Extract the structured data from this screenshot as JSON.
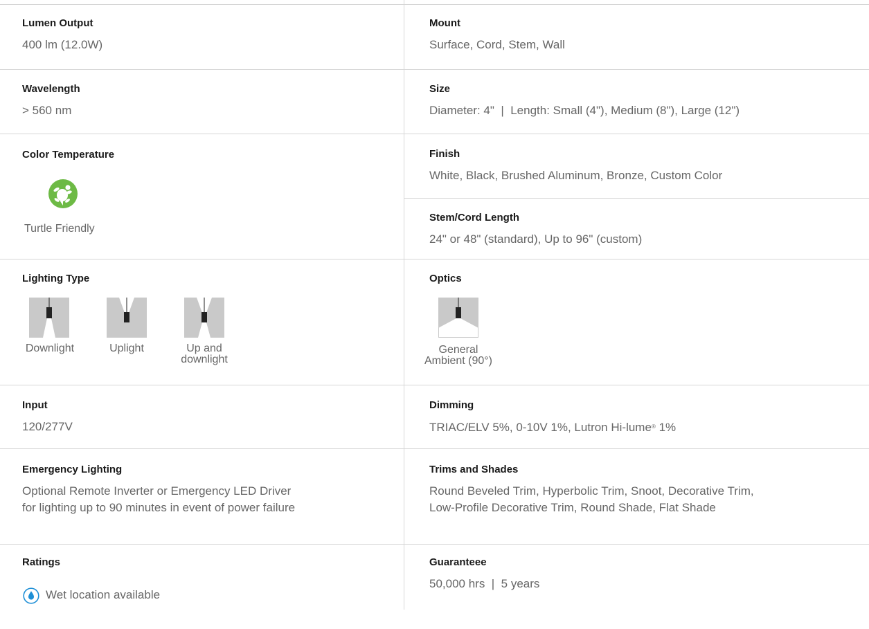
{
  "specs": {
    "lumen": {
      "label": "Lumen Output",
      "value": "400 lm (12.0W)"
    },
    "mount": {
      "label": "Mount",
      "value": "Surface, Cord, Stem, Wall"
    },
    "wavelength": {
      "label": "Wavelength",
      "value": "> 560 nm"
    },
    "size": {
      "label": "Size",
      "value": "Diameter: 4\"  |  Length: Small (4\"), Medium (8\"), Large (12\")"
    },
    "color_temp": {
      "label": "Color Temperature",
      "badge": "Turtle Friendly",
      "icon": "turtle-icon"
    },
    "finish": {
      "label": "Finish",
      "value": "White, Black, Brushed Aluminum, Bronze, Custom Color"
    },
    "stem_cord": {
      "label": "Stem/Cord Length",
      "value": "24\" or 48\" (standard), Up to 96\" (custom)"
    },
    "lighting_type": {
      "label": "Lighting Type",
      "options": [
        {
          "caption": "Downlight"
        },
        {
          "caption": "Uplight"
        },
        {
          "caption_line1": "Up and",
          "caption_line2": "downlight"
        }
      ]
    },
    "optics": {
      "label": "Optics",
      "caption_line1": "General",
      "caption_line2": "Ambient (90°)"
    },
    "input": {
      "label": "Input",
      "value": "120/277V"
    },
    "dimming": {
      "label": "Dimming",
      "value_pre": "TRIAC/ELV 5%, 0-10V 1%, Lutron Hi-lume",
      "value_reg": "®",
      "value_post": " 1%"
    },
    "emergency": {
      "label": "Emergency Lighting",
      "line1": "Optional Remote Inverter or Emergency LED Driver",
      "line2": "for lighting up to 90 minutes in event of power failure"
    },
    "trims": {
      "label": "Trims and Shades",
      "line1": "Round Beveled Trim, Hyperbolic Trim, Snoot, Decorative Trim,",
      "line2": "Low-Profile Decorative Trim, Round Shade, Flat Shade"
    },
    "ratings": {
      "label": "Ratings",
      "value": "Wet location available",
      "icon": "water-drop-icon"
    },
    "guarantee": {
      "label": "Guaranteee",
      "value": "50,000 hrs  |  5 years"
    }
  },
  "colors": {
    "accent_green": "#6dba45",
    "accent_blue": "#1e8fd6",
    "divider": "#d6d6d6"
  }
}
